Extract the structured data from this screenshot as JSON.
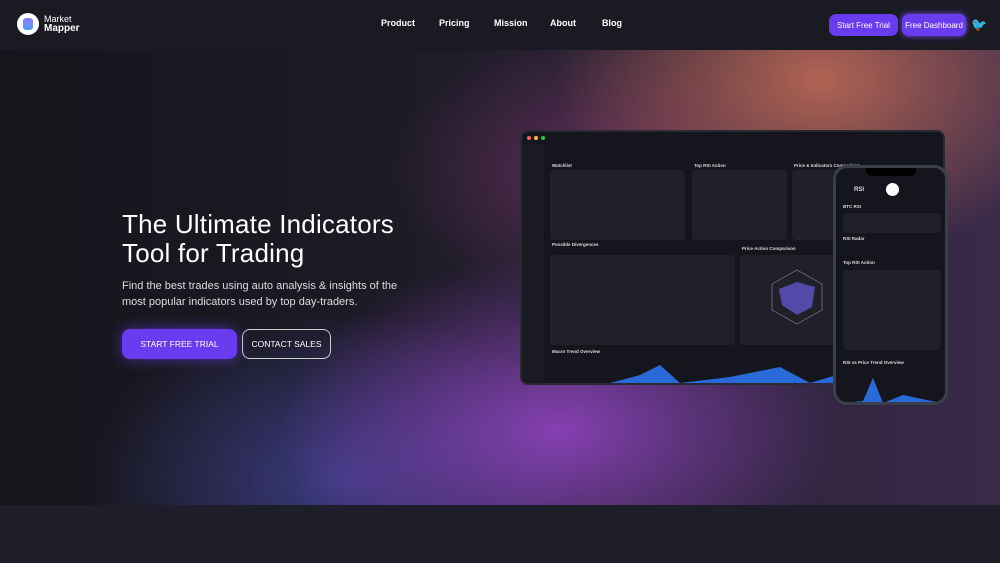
{
  "header": {
    "brand_line1": "Market",
    "brand_line2": "Mapper",
    "nav": [
      "Product",
      "Pricing",
      "Mission",
      "About",
      "Blog"
    ],
    "start_trial": "Start Free Trial",
    "free_dashboard": "Free Dashboard",
    "twitter_icon": "twitter-icon"
  },
  "hero": {
    "title_line1": "The Ultimate Indicators",
    "title_line2": "Tool for Trading",
    "subtitle": "Find the best trades using auto analysis & insights of the most popular indicators used by top day-traders.",
    "cta_primary": "START FREE TRIAL",
    "cta_secondary": "CONTACT SALES"
  },
  "mockup": {
    "laptop": {
      "panels": [
        "Watchlist",
        "Top RSI Action",
        "Price & Indicators Comparison",
        "Possible Divergences",
        "Price Action Comparison",
        "Macro Trend Overview"
      ]
    },
    "phone": {
      "title": "RSI",
      "sections": [
        "BTC RSI",
        "RSI Radar",
        "Top RSI Action",
        "RSI vs Price Trend Overview"
      ]
    }
  },
  "colors": {
    "accent": "#6a3cf0",
    "header_bg": "#1a1a23"
  }
}
